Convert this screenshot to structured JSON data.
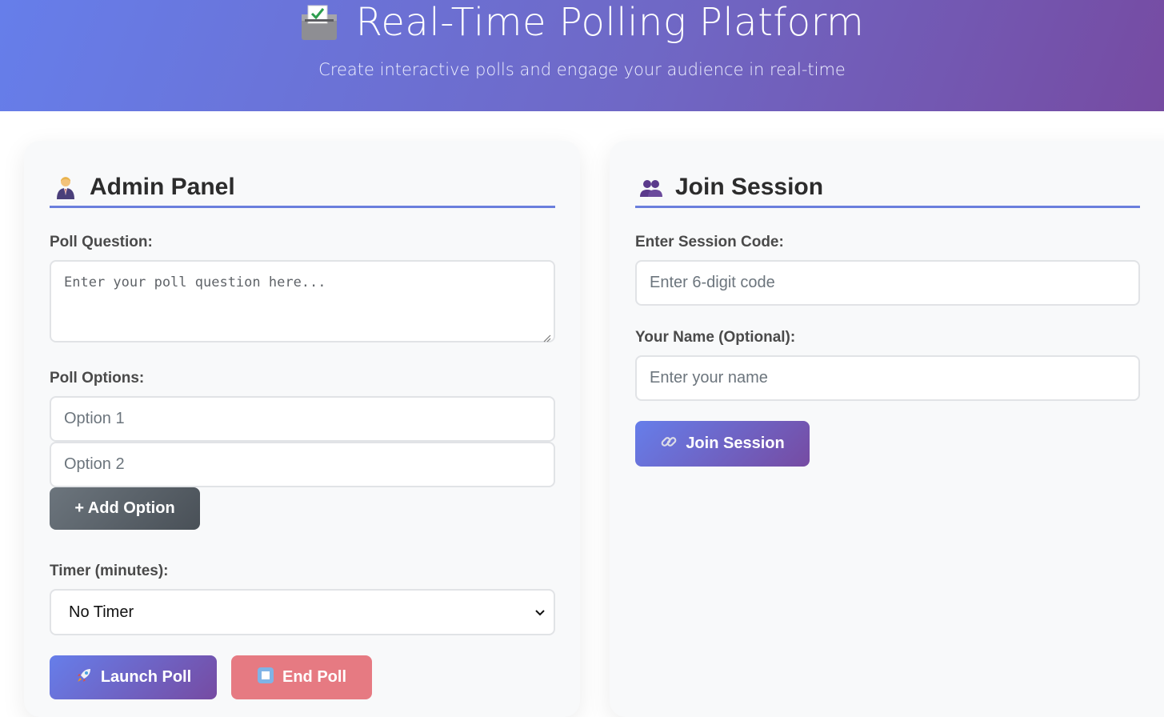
{
  "header": {
    "title": "Real-Time Polling Platform",
    "subtitle": "Create interactive polls and engage your audience in real-time",
    "icon": "ballot-box-icon"
  },
  "admin": {
    "title": "Admin Panel",
    "icon": "admin-person-icon",
    "question_label": "Poll Question:",
    "question_placeholder": "Enter your poll question here...",
    "options_label": "Poll Options:",
    "options": [
      {
        "placeholder": "Option 1"
      },
      {
        "placeholder": "Option 2"
      }
    ],
    "add_option_label": "+ Add Option",
    "timer_label": "Timer (minutes):",
    "timer_selected": "No Timer",
    "launch_label": "Launch Poll",
    "end_label": "End Poll"
  },
  "join": {
    "title": "Join Session",
    "icon": "people-icon",
    "code_label": "Enter Session Code:",
    "code_placeholder": "Enter 6-digit code",
    "name_label": "Your Name (Optional):",
    "name_placeholder": "Enter your name",
    "join_label": "Join Session"
  },
  "colors": {
    "accent_start": "#667eea",
    "accent_end": "#764ba2",
    "gray_button": "#6c757d",
    "danger_button": "#e67a82",
    "panel_bg": "#f8f9fa"
  }
}
